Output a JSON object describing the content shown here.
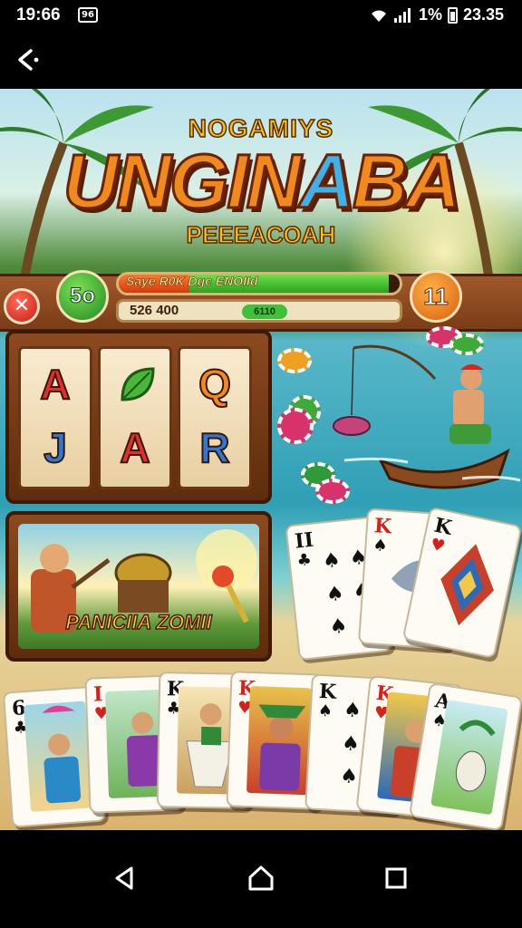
{
  "status_bar": {
    "time": "19:66",
    "badge": "96",
    "battery": "1%",
    "clock_right": "23.35"
  },
  "top_bar": {
    "back_icon": "back-arrow-icon"
  },
  "game": {
    "logo": {
      "top": "NOGAMIYS",
      "main_a": "UNGIN",
      "main_b": "A",
      "main_c": "BA",
      "sub": "PEEEACOAH"
    },
    "hud": {
      "close_icon": "close-icon",
      "level": "5o",
      "progress_label": "Saye R0K Dgc ENOIId",
      "progress_fraction": 0.96,
      "progress_red_fraction": 0.25,
      "score": "526 400",
      "bonus": "6110",
      "count": "11"
    },
    "slot": {
      "reels": [
        {
          "top": "A",
          "bottom": "J"
        },
        {
          "top": "",
          "bottom": "A"
        },
        {
          "top": "Q",
          "bottom": "R"
        }
      ]
    },
    "panel": {
      "title": "PANICIIA ZOMII"
    },
    "right_cards": [
      {
        "rank": "II",
        "suit": "♣",
        "color": "black"
      },
      {
        "rank": "K",
        "suit": "♠",
        "color": "red"
      },
      {
        "rank": "K",
        "suit": "♥",
        "color": "black"
      }
    ],
    "bottom_cards": [
      {
        "rank": "6",
        "suit": "♣",
        "color": "black"
      },
      {
        "rank": "I",
        "suit": "♥",
        "color": "red"
      },
      {
        "rank": "K",
        "suit": "♣",
        "color": "black"
      },
      {
        "rank": "K",
        "suit": "♥",
        "color": "red"
      },
      {
        "rank": "K",
        "suit": "♠",
        "color": "black"
      },
      {
        "rank": "K",
        "suit": "♥",
        "color": "red"
      },
      {
        "rank": "A",
        "suit": "♠",
        "color": "black"
      }
    ]
  },
  "nav_bar": {
    "back": "nav-back-icon",
    "home": "nav-home-icon",
    "recents": "nav-recents-icon"
  }
}
